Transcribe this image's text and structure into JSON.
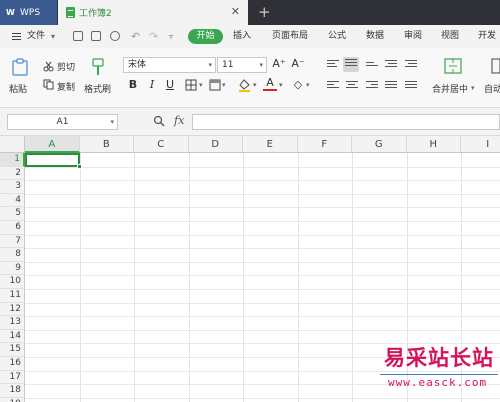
{
  "titlebar": {
    "app_tab": "WPS",
    "doc_tab": "工作簿2",
    "close": "✕",
    "new_tab": "+"
  },
  "menubar": {
    "file": "文件",
    "file_dd": "▾",
    "start": "开始",
    "tabs": [
      "插入",
      "页面布局",
      "公式",
      "数据",
      "审阅",
      "视图",
      "开发工"
    ]
  },
  "ribbon": {
    "paste": "粘贴",
    "cut": "剪切",
    "copy": "复制",
    "format_painter": "格式刷",
    "font_name": "宋体",
    "font_size": "11",
    "grow_font": "A⁺",
    "shrink_font": "A⁻",
    "bold": "B",
    "italic": "I",
    "underline": "U",
    "merge_center": "合并居中",
    "auto_wrap": "自动"
  },
  "formulabar": {
    "cell_ref": "A1",
    "fx": "fx"
  },
  "grid": {
    "columns": [
      "A",
      "B",
      "C",
      "D",
      "E",
      "F",
      "G",
      "H",
      "I"
    ],
    "rows": [
      "1",
      "2",
      "3",
      "4",
      "5",
      "6",
      "7",
      "8",
      "9",
      "10",
      "11",
      "12",
      "13",
      "14",
      "15",
      "16",
      "17",
      "18",
      "19"
    ]
  },
  "watermark": {
    "cn": "易采站长站",
    "en": "www.easck.com"
  },
  "colors": {
    "accent": "#3aa64f",
    "wps_blue": "#3b5a90",
    "watermark": "#d4145a"
  }
}
